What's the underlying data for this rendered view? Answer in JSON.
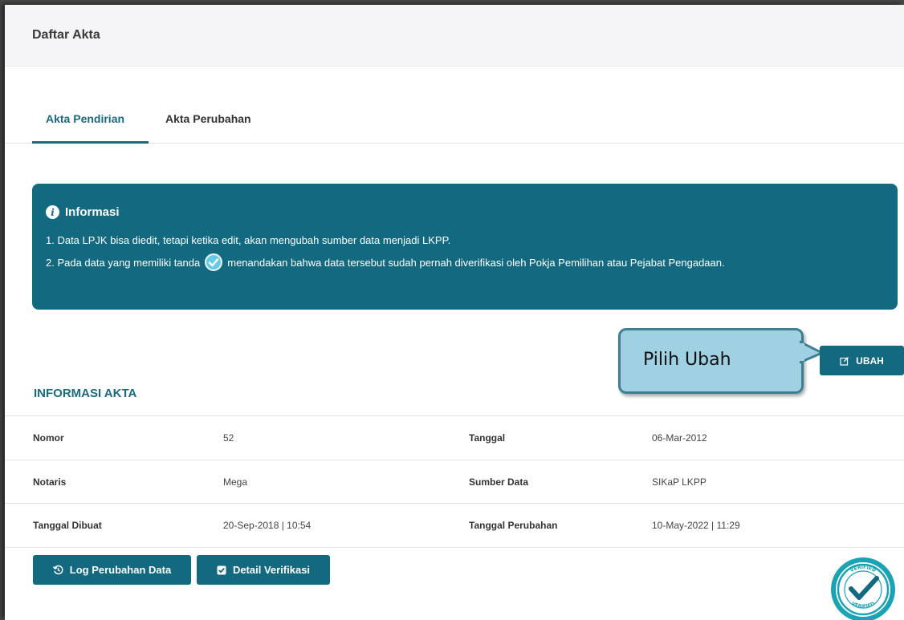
{
  "header": {
    "title": "Daftar Akta"
  },
  "tabs": [
    {
      "label": "Akta Pendirian",
      "active": true
    },
    {
      "label": "Akta Perubahan",
      "active": false
    }
  ],
  "info": {
    "title": "Informasi",
    "line1": "1. Data LPJK bisa diedit, tetapi ketika edit, akan mengubah sumber data menjadi LKPP.",
    "line2_pre": "2. Pada data yang memiliki tanda",
    "line2_post": "menandakan bahwa data tersebut sudah pernah diverifikasi oleh Pokja Pemilihan atau Pejabat Pengadaan."
  },
  "callout": {
    "text": "Pilih Ubah"
  },
  "actions": {
    "ubah_label": "UBAH"
  },
  "section": {
    "title": "INFORMASI AKTA"
  },
  "table": {
    "rows": [
      {
        "label1": "Nomor",
        "value1": "52",
        "label2": "Tanggal",
        "value2": "06-Mar-2012"
      },
      {
        "label1": "Notaris",
        "value1": "Mega",
        "label2": "Sumber Data",
        "value2": "SIKaP LKPP"
      },
      {
        "label1": "Tanggal Dibuat",
        "value1": "20-Sep-2018 | 10:54",
        "label2": "Tanggal Perubahan",
        "value2": "10-May-2022 | 11:29"
      }
    ]
  },
  "footer": {
    "log_label": "Log Perubahan Data",
    "detail_label": "Detail Verifikasi"
  },
  "stamp": {
    "top_text": "VERIFIED",
    "bottom_text": "VERIFIED"
  },
  "colors": {
    "primary": "#136a80",
    "callout_fill": "#9fd1e3",
    "callout_border": "#3f7f94",
    "verified_badge": "#6cc9e6"
  }
}
